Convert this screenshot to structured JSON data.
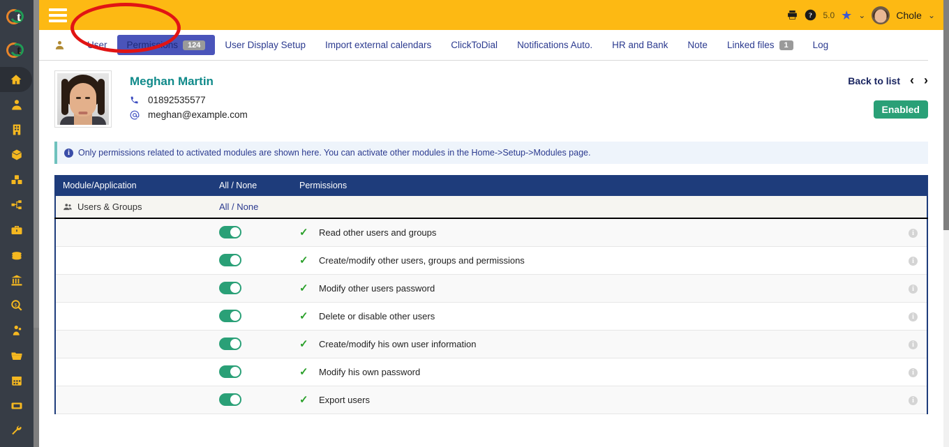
{
  "sidebar": {
    "logos": [
      {
        "name": "app-logo-top"
      },
      {
        "name": "app-logo-second"
      }
    ],
    "items": [
      {
        "icon": "home-icon",
        "label": "Home",
        "active": true
      },
      {
        "icon": "user-icon",
        "label": "Third parties"
      },
      {
        "icon": "building-icon",
        "label": "Products"
      },
      {
        "icon": "box-icon",
        "label": "Stock"
      },
      {
        "icon": "boxes-icon",
        "label": "MRP"
      },
      {
        "icon": "project-icon",
        "label": "Projects"
      },
      {
        "icon": "briefcase-icon",
        "label": "Commercial"
      },
      {
        "icon": "coins-icon",
        "label": "Billing"
      },
      {
        "icon": "bank-icon",
        "label": "Bank"
      },
      {
        "icon": "accounting-search-icon",
        "label": "Accounting"
      },
      {
        "icon": "hrm-icon",
        "label": "HRM"
      },
      {
        "icon": "folder-icon",
        "label": "Documents"
      },
      {
        "icon": "calendar-icon",
        "label": "Agenda"
      },
      {
        "icon": "ticket-icon",
        "label": "Tickets"
      },
      {
        "icon": "wrench-icon",
        "label": "Tools"
      }
    ]
  },
  "topbar": {
    "menu_icon": "hamburger-icon",
    "print_icon": "printer-icon",
    "help_icon": "help-icon",
    "version": "5.0",
    "bookmark_icon": "star-icon",
    "bookmark_caret": "⌄",
    "user_name": "Chole",
    "user_caret": "⌄"
  },
  "tabs": {
    "leading_icon": "user-card-icon",
    "items": [
      {
        "label": "User",
        "badge": null,
        "active": false
      },
      {
        "label": "Permissions",
        "badge": "124",
        "active": true
      },
      {
        "label": "User Display Setup",
        "badge": null,
        "active": false
      },
      {
        "label": "Import external calendars",
        "badge": null,
        "active": false
      },
      {
        "label": "ClickToDial",
        "badge": null,
        "active": false
      },
      {
        "label": "Notifications Auto.",
        "badge": null,
        "active": false
      },
      {
        "label": "HR and Bank",
        "badge": null,
        "active": false
      },
      {
        "label": "Note",
        "badge": null,
        "active": false
      },
      {
        "label": "Linked files",
        "badge": "1",
        "active": false
      },
      {
        "label": "Log",
        "badge": null,
        "active": false
      }
    ]
  },
  "annotation": {
    "shape": "ellipse",
    "color": "#e11414",
    "target": "Permissions"
  },
  "user": {
    "avatar": "user-photo",
    "full_name": "Meghan Martin",
    "phone_icon": "phone-icon",
    "phone": "01892535577",
    "email_icon": "at-icon",
    "email": "meghan@example.com",
    "back_to_list": "Back to list",
    "prev_icon": "‹",
    "next_icon": "›",
    "status": "Enabled",
    "status_color": "#2aa077",
    "name_color": "#108a8a"
  },
  "info_banner": {
    "icon": "info-icon",
    "text": "Only permissions related to activated modules are shown here. You can activate other modules in the Home->Setup->Modules page."
  },
  "table": {
    "headers": {
      "module": "Module/Application",
      "allnone": "All  /  None",
      "permissions": "Permissions",
      "info": ""
    },
    "header_color": "#1e3c7b",
    "group": {
      "icon": "users-group-icon",
      "name": "Users & Groups",
      "all_none": "All / None"
    },
    "rows": [
      {
        "toggle": true,
        "check": "✓",
        "label": "Read other users and groups",
        "info": "i"
      },
      {
        "toggle": true,
        "check": "✓",
        "label": "Create/modify other users, groups and permissions",
        "info": "i"
      },
      {
        "toggle": true,
        "check": "✓",
        "label": "Modify other users password",
        "info": "i"
      },
      {
        "toggle": true,
        "check": "✓",
        "label": "Delete or disable other users",
        "info": "i"
      },
      {
        "toggle": true,
        "check": "✓",
        "label": "Create/modify his own user information",
        "info": "i"
      },
      {
        "toggle": true,
        "check": "✓",
        "label": "Modify his own password",
        "info": "i"
      },
      {
        "toggle": true,
        "check": "✓",
        "label": "Export users",
        "info": "i"
      }
    ]
  }
}
